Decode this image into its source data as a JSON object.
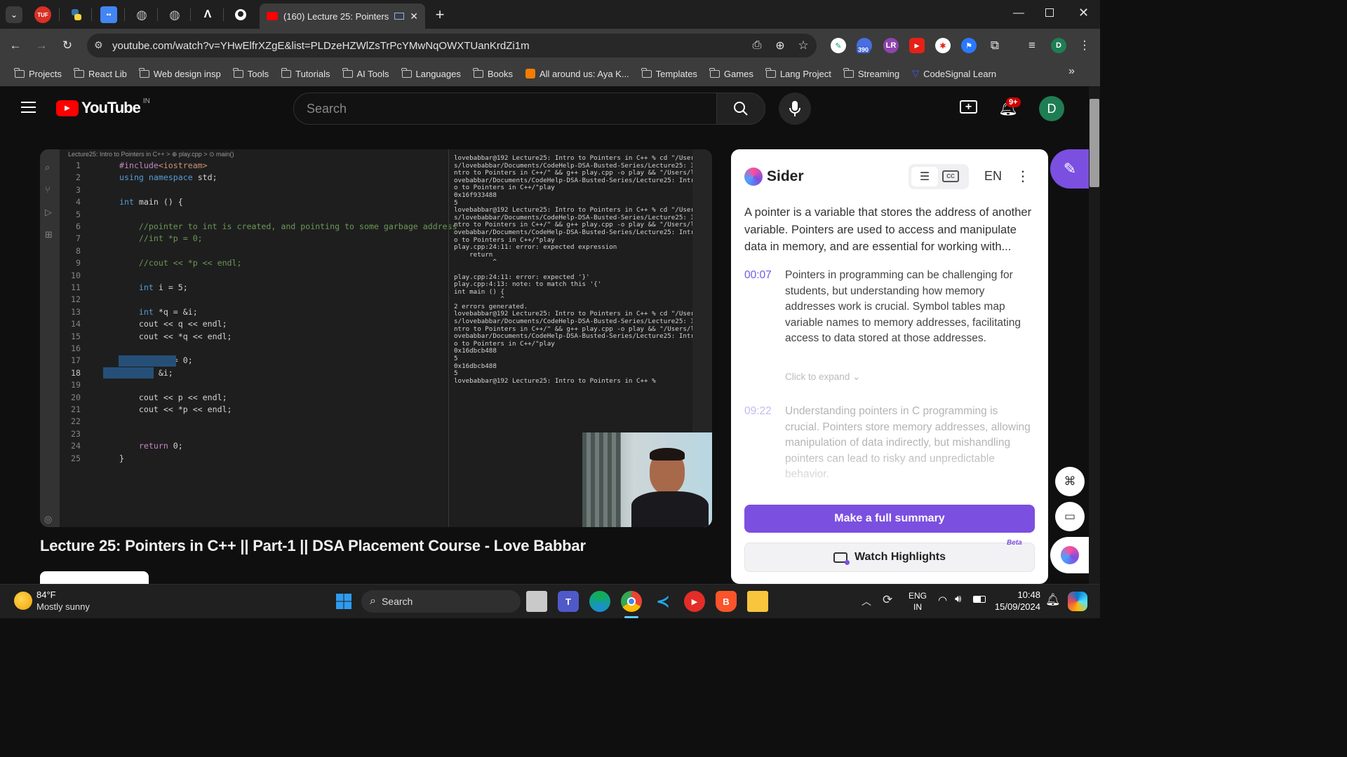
{
  "browser": {
    "tab_title": "(160) Lecture 25: Pointers in",
    "url": "youtube.com/watch?v=YHwElfrXZgE&list=PLDzeHZWlZsTrPcYMwNqOWXTUanKrdZi1m",
    "tab_icons": [
      "TUF",
      "python-icon",
      "app-icon",
      "globe-icon",
      "globe-icon",
      "A",
      "github-icon"
    ],
    "ext_badge": "390",
    "profile_initial": "D",
    "bookmarks": [
      {
        "label": "Projects",
        "type": "folder"
      },
      {
        "label": "React Lib",
        "type": "folder"
      },
      {
        "label": "Web design insp",
        "type": "folder"
      },
      {
        "label": "Tools",
        "type": "folder"
      },
      {
        "label": "Tutorials",
        "type": "folder"
      },
      {
        "label": "AI Tools",
        "type": "folder"
      },
      {
        "label": "Languages",
        "type": "folder"
      },
      {
        "label": "Books",
        "type": "folder"
      },
      {
        "label": "All around us: Aya K...",
        "type": "page"
      },
      {
        "label": "Templates",
        "type": "folder"
      },
      {
        "label": "Games",
        "type": "folder"
      },
      {
        "label": "Lang Project",
        "type": "folder"
      },
      {
        "label": "Streaming",
        "type": "folder"
      },
      {
        "label": "CodeSignal Learn",
        "type": "page"
      }
    ]
  },
  "youtube": {
    "logo_text": "YouTube",
    "region": "IN",
    "search_placeholder": "Search",
    "notif_count": "9+",
    "avatar_initial": "D",
    "video_title": "Lecture 25: Pointers in C++ || Part-1 || DSA Placement Course - Love Babbar"
  },
  "video": {
    "breadcrumb": "Lecture25: Intro to Pointers in C++ > ⊕ play.cpp > ⊙ main()",
    "code": [
      {
        "n": "1",
        "t": "#include<iostream>"
      },
      {
        "n": "2",
        "t": "using namespace std;"
      },
      {
        "n": "3",
        "t": ""
      },
      {
        "n": "4",
        "t": "int main () {"
      },
      {
        "n": "5",
        "t": ""
      },
      {
        "n": "6",
        "t": "    //pointer to int is created, and pointing to some garbage address"
      },
      {
        "n": "7",
        "t": "    //int *p = 0;"
      },
      {
        "n": "8",
        "t": ""
      },
      {
        "n": "9",
        "t": "    //cout << *p << endl;"
      },
      {
        "n": "10",
        "t": ""
      },
      {
        "n": "11",
        "t": "    int i = 5;"
      },
      {
        "n": "12",
        "t": ""
      },
      {
        "n": "13",
        "t": "    int *q = &i;"
      },
      {
        "n": "14",
        "t": "    cout << q << endl;"
      },
      {
        "n": "15",
        "t": "    cout << *q << endl;"
      },
      {
        "n": "16",
        "t": ""
      },
      {
        "n": "17",
        "t": "    int *p = 0;"
      },
      {
        "n": "18",
        "t": "    p = &i;"
      },
      {
        "n": "19",
        "t": ""
      },
      {
        "n": "20",
        "t": "    cout << p << endl;"
      },
      {
        "n": "21",
        "t": "    cout << *p << endl;"
      },
      {
        "n": "22",
        "t": ""
      },
      {
        "n": "23",
        "t": ""
      },
      {
        "n": "24",
        "t": "    return 0;"
      },
      {
        "n": "25",
        "t": "}"
      }
    ],
    "terminal": "lovebabbar@192 Lecture25: Intro to Pointers in C++ % cd \"/User\ns/lovebabbar/Documents/CodeHelp-DSA-Busted-Series/Lecture25: I\nntro to Pointers in C++/\" && g++ play.cpp -o play && \"/Users/l\novebabbar/Documents/CodeHelp-DSA-Busted-Series/Lecture25: Intr\no to Pointers in C++/\"play\n0x16f933488\n5\nlovebabbar@192 Lecture25: Intro to Pointers in C++ % cd \"/User\ns/lovebabbar/Documents/CodeHelp-DSA-Busted-Series/Lecture25: I\nntro to Pointers in C++/\" && g++ play.cpp -o play && \"/Users/l\novebabbar/Documents/CodeHelp-DSA-Busted-Series/Lecture25: Intr\no to Pointers in C++/\"play\nplay.cpp:24:11: error: expected expression\n    return\n          ^\n\nplay.cpp:24:11: error: expected '}'\nplay.cpp:4:13: note: to match this '{'\nint main () {\n            ^\n2 errors generated.\nlovebabbar@192 Lecture25: Intro to Pointers in C++ % cd \"/User\ns/lovebabbar/Documents/CodeHelp-DSA-Busted-Series/Lecture25: I\nntro to Pointers in C++/\" && g++ play.cpp -o play && \"/Users/l\novebabbar/Documents/CodeHelp-DSA-Busted-Series/Lecture25: Intr\no to Pointers in C++/\"play\n0x16dbcb488\n5\n0x16dbcb488\n5\nlovebabbar@192 Lecture25: Intro to Pointers in C++ % "
  },
  "sider": {
    "brand": "Sider",
    "lang": "EN",
    "intro": "A pointer is a variable that stores the address of another variable. Pointers are used to access and manipulate data in memory, and are essential for working with...",
    "items": [
      {
        "time": "00:07",
        "text": "Pointers in programming can be challenging for students, but understanding how memory addresses work is crucial. Symbol tables map variable names to memory addresses, facilitating access to data stored at those addresses."
      },
      {
        "time": "09:22",
        "text": "Understanding pointers in C programming is crucial. Pointers store memory addresses, allowing manipulation of data indirectly, but mishandling pointers can lead to risky and unpredictable behavior."
      }
    ],
    "expand_label": "Click to expand",
    "full_summary_label": "Make a full summary",
    "watch_highlights_label": "Watch Highlights",
    "beta_label": "Beta"
  },
  "taskbar": {
    "weather_temp": "84°F",
    "weather_desc": "Mostly sunny",
    "search_label": "Search",
    "lang_line1": "ENG",
    "lang_line2": "IN",
    "time": "10:48",
    "date": "15/09/2024"
  },
  "colors": {
    "accent": "#7b4fe0",
    "yt_red": "#ff0000",
    "sider_time": "#6e5ce6"
  }
}
